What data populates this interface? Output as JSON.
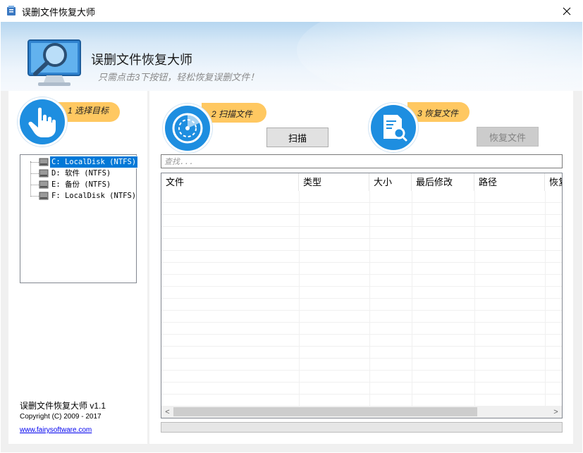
{
  "window": {
    "title": "误删文件恢复大师",
    "close_glyph": "✕"
  },
  "banner": {
    "title": "误删文件恢复大师",
    "subtitle": "只需点击3下按钮，轻松恢复误删文件！"
  },
  "steps": [
    {
      "label": "1 选择目标",
      "icon": "hand-pointer-icon"
    },
    {
      "label": "2 扫描文件",
      "icon": "radar-scan-icon"
    },
    {
      "label": "3 恢复文件",
      "icon": "document-search-icon"
    }
  ],
  "drives": [
    {
      "label": "C: LocalDisk (NTFS)",
      "selected": true
    },
    {
      "label": "D: 软件 (NTFS)",
      "selected": false
    },
    {
      "label": "E: 备份 (NTFS)",
      "selected": false
    },
    {
      "label": "F: LocalDisk (NTFS)",
      "selected": false
    }
  ],
  "buttons": {
    "scan": "扫描",
    "recover": "恢复文件"
  },
  "search": {
    "placeholder": "查找..."
  },
  "table": {
    "columns": [
      "文件",
      "类型",
      "大小",
      "最后修改",
      "路径",
      "恢复"
    ]
  },
  "footer": {
    "version": "误删文件恢复大师 v1.1",
    "copyright": "Copyright (C) 2009 - 2017",
    "website": "www.fairysoftware.com"
  },
  "scrollbar": {
    "left_arrow": "<",
    "right_arrow": ">"
  },
  "colors": {
    "accent_blue": "#1e8ee0",
    "step_pill": "#ffc861",
    "selection": "#0078d7"
  }
}
